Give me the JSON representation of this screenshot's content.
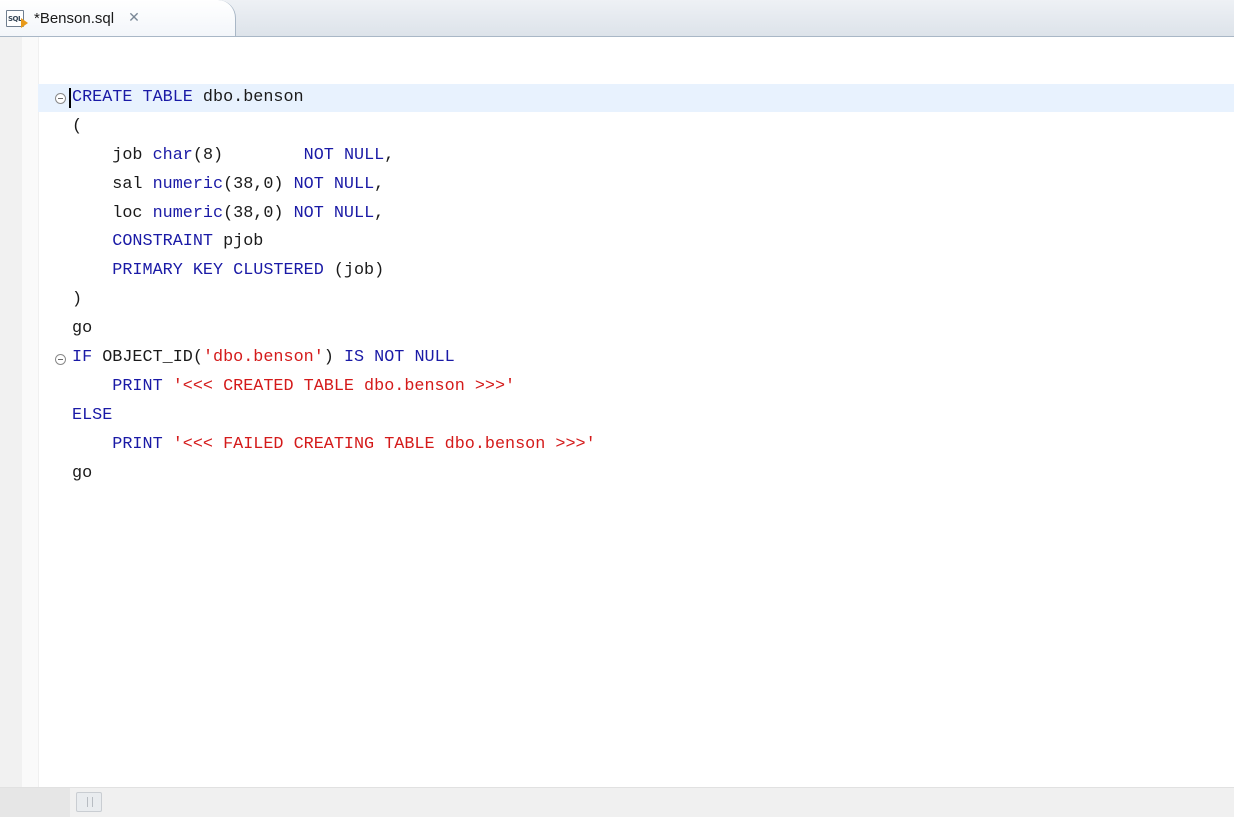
{
  "tab": {
    "icon_text": "SQL",
    "title": "*Benson.sql",
    "close_glyph": "✕"
  },
  "editor": {
    "lines": [
      [
        {
          "t": "CREATE TABLE ",
          "c": "kw"
        },
        {
          "t": "dbo.benson",
          "c": ""
        }
      ],
      [
        {
          "t": "(",
          "c": ""
        }
      ],
      [
        {
          "t": "    job ",
          "c": ""
        },
        {
          "t": "char",
          "c": "kw"
        },
        {
          "t": "(8)        ",
          "c": ""
        },
        {
          "t": "NOT NULL",
          "c": "kw"
        },
        {
          "t": ",",
          "c": ""
        }
      ],
      [
        {
          "t": "    sal ",
          "c": ""
        },
        {
          "t": "numeric",
          "c": "kw"
        },
        {
          "t": "(38,0) ",
          "c": ""
        },
        {
          "t": "NOT NULL",
          "c": "kw"
        },
        {
          "t": ",",
          "c": ""
        }
      ],
      [
        {
          "t": "    loc ",
          "c": ""
        },
        {
          "t": "numeric",
          "c": "kw"
        },
        {
          "t": "(38,0) ",
          "c": ""
        },
        {
          "t": "NOT NULL",
          "c": "kw"
        },
        {
          "t": ",",
          "c": ""
        }
      ],
      [
        {
          "t": "    CONSTRAINT ",
          "c": "kw"
        },
        {
          "t": "pjob",
          "c": ""
        }
      ],
      [
        {
          "t": "    PRIMARY KEY CLUSTERED ",
          "c": "kw"
        },
        {
          "t": "(job)",
          "c": ""
        }
      ],
      [
        {
          "t": ")",
          "c": ""
        }
      ],
      [
        {
          "t": "go",
          "c": ""
        }
      ],
      [
        {
          "t": "IF ",
          "c": "kw"
        },
        {
          "t": "OBJECT_ID(",
          "c": ""
        },
        {
          "t": "'dbo.benson'",
          "c": "str"
        },
        {
          "t": ") ",
          "c": ""
        },
        {
          "t": "IS NOT NULL",
          "c": "kw"
        }
      ],
      [
        {
          "t": "    PRINT ",
          "c": "kw"
        },
        {
          "t": "'<<< CREATED TABLE dbo.benson >>>'",
          "c": "str"
        }
      ],
      [
        {
          "t": "ELSE",
          "c": "kw"
        }
      ],
      [
        {
          "t": "    PRINT ",
          "c": "kw"
        },
        {
          "t": "'<<< FAILED CREATING TABLE dbo.benson >>>'",
          "c": "str"
        }
      ],
      [
        {
          "t": "go",
          "c": ""
        }
      ]
    ]
  },
  "colors": {
    "keyword": "#1a1aa6",
    "string": "#d41a1a",
    "current_line": "#e8f2fe"
  }
}
